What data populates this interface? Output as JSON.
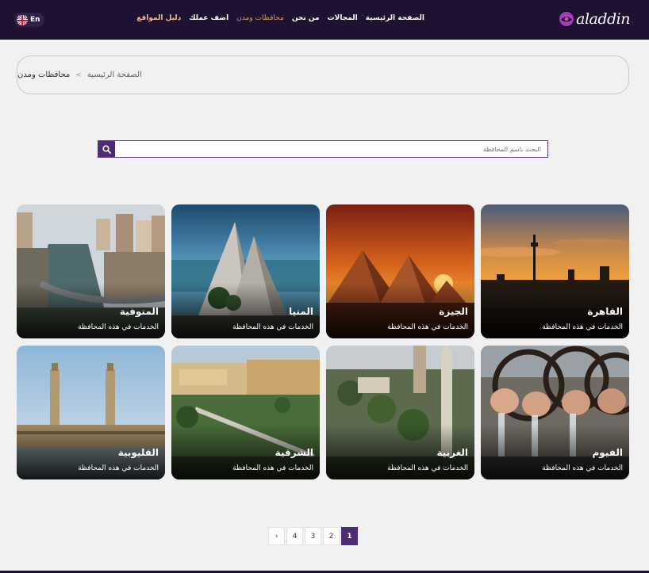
{
  "header": {
    "logo_text": "aladdin",
    "language_label": "En",
    "nav": [
      {
        "label": "الصفحة الرئيسية"
      },
      {
        "label": "المجالات"
      },
      {
        "label": "من نحن"
      },
      {
        "label": "محافظات ومدن"
      },
      {
        "label": "اضف عملك"
      },
      {
        "label": "دليل المواقع"
      }
    ]
  },
  "breadcrumb": {
    "home": "الصفحة الرئيسية",
    "separator": ">",
    "current": "محافظات ومدن"
  },
  "search": {
    "placeholder": "البحث باسم المحافظة"
  },
  "cards_subtitle": "الخدمات في هذه المحافظة",
  "cards": [
    {
      "name": "القاهرة",
      "subtitle": "الخدمات في هذه المحافظة"
    },
    {
      "name": "الجيزة",
      "subtitle": "الخدمات في هذه المحافظة"
    },
    {
      "name": "المنيا",
      "subtitle": "الخدمات في هذه المحافظة"
    },
    {
      "name": "المنوفية",
      "subtitle": "الخدمات في هذه المحافظة"
    },
    {
      "name": "الفيوم",
      "subtitle": "الخدمات في هذه المحافظة"
    },
    {
      "name": "الغربية",
      "subtitle": "الخدمات في هذه المحافظة"
    },
    {
      "name": "الشرقية",
      "subtitle": "الخدمات في هذه المحافظة"
    },
    {
      "name": "القليوبية",
      "subtitle": "الخدمات في هذه المحافظة"
    }
  ],
  "pagination": {
    "current": "1",
    "pages": [
      "2",
      "3",
      "4"
    ],
    "next": "›"
  },
  "colors": {
    "header_bg": "#1f1230",
    "accent": "#4e2b74",
    "active_nav": "#d49a6c"
  }
}
